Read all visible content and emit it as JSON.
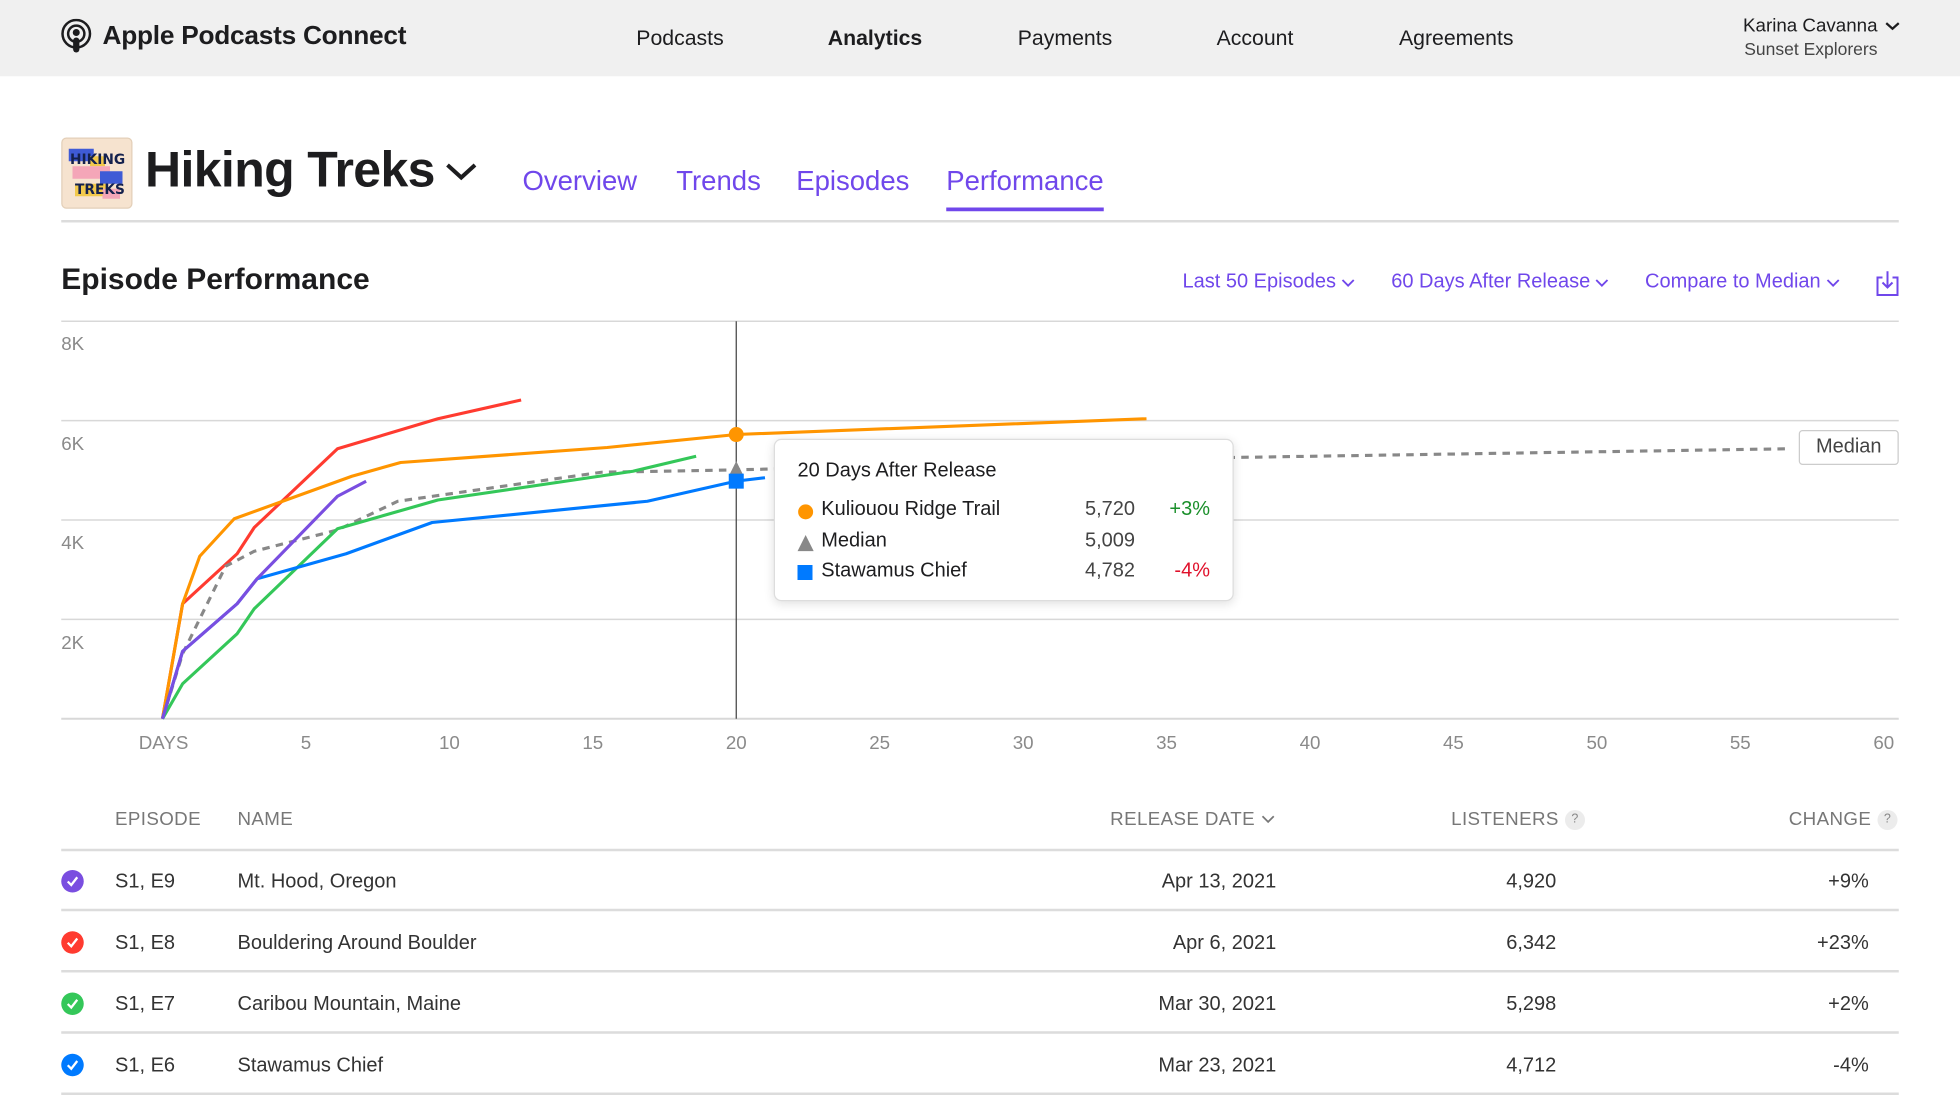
{
  "topbar": {
    "brand": "Apple Podcasts Connect",
    "nav": [
      {
        "label": "Podcasts",
        "active": false
      },
      {
        "label": "Analytics",
        "active": true
      },
      {
        "label": "Payments",
        "active": false
      },
      {
        "label": "Account",
        "active": false
      },
      {
        "label": "Agreements",
        "active": false
      }
    ],
    "user_name": "Karina Cavanna",
    "user_org": "Sunset Explorers"
  },
  "podcast": {
    "title": "Hiking Treks",
    "artwork_text": "HIKING TREKS",
    "tabs": [
      {
        "label": "Overview",
        "active": false
      },
      {
        "label": "Trends",
        "active": false
      },
      {
        "label": "Episodes",
        "active": false
      },
      {
        "label": "Performance",
        "active": true
      }
    ]
  },
  "section": {
    "title": "Episode Performance",
    "filters": [
      "Last 50 Episodes",
      "60 Days After Release",
      "Compare to Median"
    ],
    "export_icon": "download-icon"
  },
  "chart_data": {
    "type": "line",
    "xlabel": "DAYS",
    "x_ticks": [
      "DAYS",
      "5",
      "10",
      "15",
      "20",
      "25",
      "30",
      "35",
      "40",
      "45",
      "50",
      "55",
      "60"
    ],
    "y_ticks": [
      "2K",
      "4K",
      "6K",
      "8K"
    ],
    "xlim": [
      0,
      60
    ],
    "ylim": [
      0,
      8000
    ],
    "grid": true,
    "median_label": "Median",
    "series": [
      {
        "name": "Bouldering Around Boulder",
        "color": "#ff3b30",
        "dashed": false,
        "x": [
          0,
          0.7,
          2.6,
          3.2,
          6.1,
          9.6,
          12.5
        ],
        "y": [
          0,
          2314,
          3321,
          3849,
          5434,
          6038,
          6415
        ]
      },
      {
        "name": "Kuliouou Ridge Trail",
        "color": "#ff9500",
        "dashed": false,
        "x": [
          0,
          0.7,
          1.3,
          2.5,
          6.6,
          8.3,
          15.5,
          20,
          34.3
        ],
        "y": [
          0,
          2314,
          3270,
          4025,
          4880,
          5157,
          5459,
          5720,
          6038
        ]
      },
      {
        "name": "Median",
        "color": "#888888",
        "dashed": true,
        "x": [
          0,
          0.7,
          2.2,
          3.2,
          6.1,
          8.2,
          15.3,
          20,
          37.3,
          56.7
        ],
        "y": [
          0,
          1308,
          3069,
          3371,
          3799,
          4377,
          4960,
          5009,
          5258,
          5434
        ]
      },
      {
        "name": "Caribou Mountain, Maine",
        "color": "#34c759",
        "dashed": false,
        "x": [
          0,
          0.7,
          2.6,
          3.2,
          6.1,
          9.6,
          16.4,
          18.6
        ],
        "y": [
          0,
          704,
          1711,
          2214,
          3824,
          4402,
          4981,
          5283
        ]
      },
      {
        "name": "Stawamus Chief",
        "color": "#007aff",
        "dashed": false,
        "x": [
          0,
          0.7,
          2.6,
          3.3,
          6.4,
          9.4,
          16.9,
          20,
          21
        ],
        "y": [
          0,
          1358,
          2314,
          2817,
          3321,
          3950,
          4377,
          4782,
          4850
        ]
      },
      {
        "name": "Mt. Hood, Oregon",
        "color": "#7a4ee0",
        "dashed": false,
        "x": [
          0,
          0.7,
          2.6,
          3.3,
          6.1,
          7.1
        ],
        "y": [
          0,
          1358,
          2314,
          2817,
          4478,
          4780
        ]
      }
    ],
    "crosshair_day": 20,
    "tooltip": {
      "title": "20 Days After Release",
      "rows": [
        {
          "marker": "circle",
          "color": "#ff9500",
          "label": "Kuliouou Ridge Trail",
          "value": "5,720",
          "change": "+3%",
          "trend": "pos"
        },
        {
          "marker": "triangle",
          "color": "#888888",
          "label": "Median",
          "value": "5,009",
          "change": "",
          "trend": ""
        },
        {
          "marker": "square",
          "color": "#007aff",
          "label": "Stawamus Chief",
          "value": "4,782",
          "change": "-4%",
          "trend": "neg"
        }
      ]
    }
  },
  "table": {
    "headers": {
      "episode": "EPISODE",
      "name": "NAME",
      "release_date": "RELEASE DATE",
      "listeners": "LISTENERS",
      "change": "CHANGE",
      "help": "?"
    },
    "rows": [
      {
        "color": "#7a4ee0",
        "episode": "S1, E9",
        "name": "Mt. Hood, Oregon",
        "release_date": "Apr 13, 2021",
        "listeners": "4,920",
        "change": "+9%",
        "trend": "pos"
      },
      {
        "color": "#ff3b30",
        "episode": "S1, E8",
        "name": "Bouldering Around Boulder",
        "release_date": "Apr 6, 2021",
        "listeners": "6,342",
        "change": "+23%",
        "trend": "pos"
      },
      {
        "color": "#34c759",
        "episode": "S1, E7",
        "name": "Caribou Mountain, Maine",
        "release_date": "Mar 30, 2021",
        "listeners": "5,298",
        "change": "+2%",
        "trend": "pos"
      },
      {
        "color": "#007aff",
        "episode": "S1, E6",
        "name": "Stawamus Chief",
        "release_date": "Mar 23, 2021",
        "listeners": "4,712",
        "change": "-4%",
        "trend": "neg"
      }
    ]
  }
}
